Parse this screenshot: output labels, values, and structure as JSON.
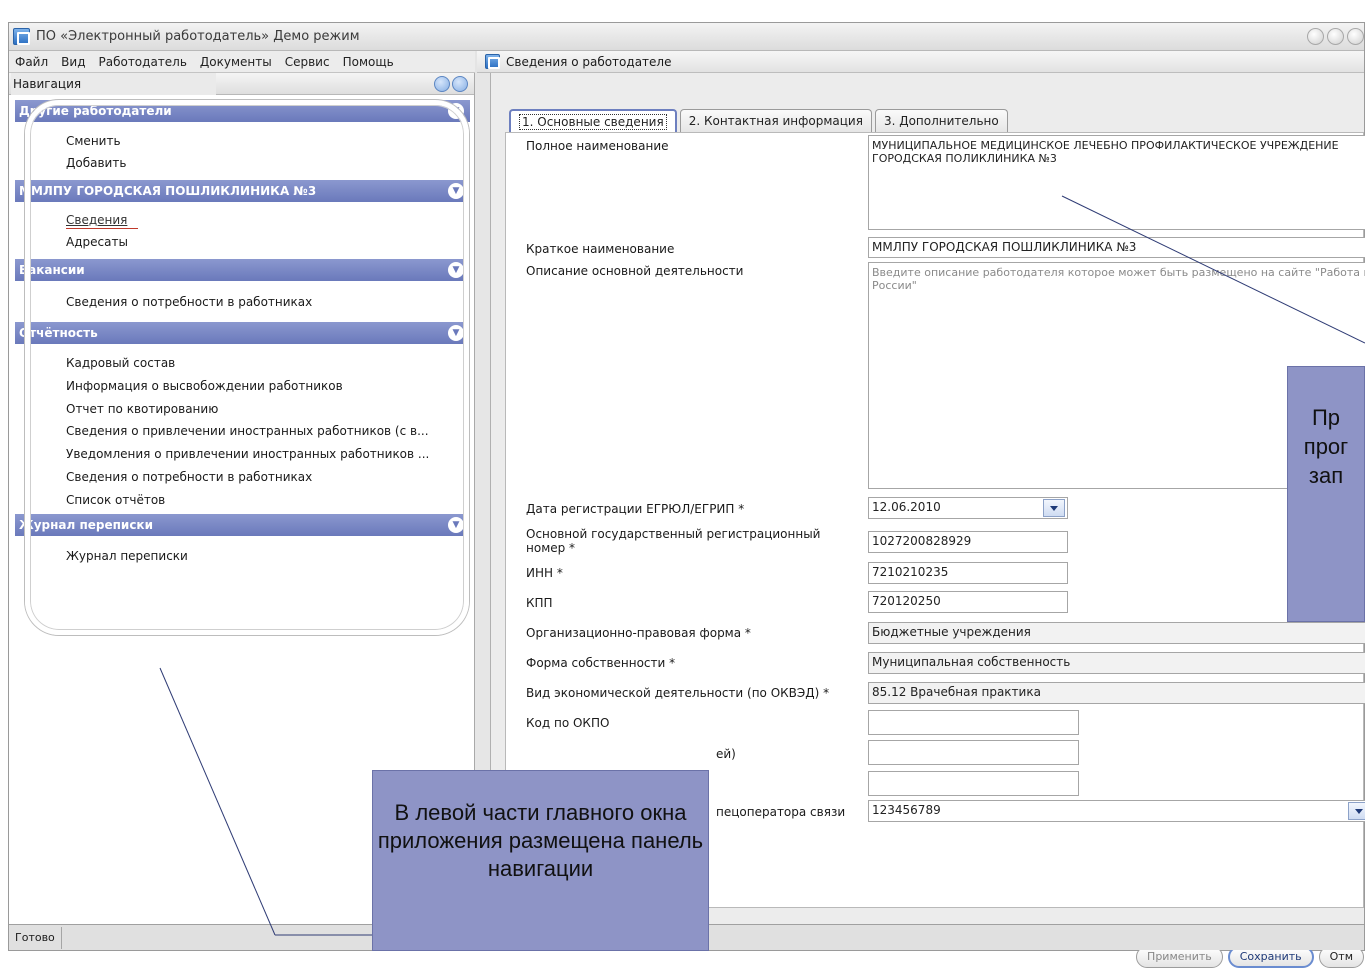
{
  "window": {
    "title": "ПО «Электронный работодатель» Демо режим"
  },
  "menu": [
    "Файл",
    "Вид",
    "Работодатель",
    "Документы",
    "Сервис",
    "Помощь"
  ],
  "document": {
    "title": "Сведения о работодателе"
  },
  "navigation": {
    "header": "Навигация",
    "sections": [
      {
        "title": "Другие работодатели",
        "items": [
          "Сменить",
          "Добавить"
        ]
      },
      {
        "title": "ММЛПУ ГОРОДСКАЯ ПОШЛИКЛИНИКА №3",
        "items": [
          "Сведения",
          "Адресаты"
        ]
      },
      {
        "title": "Вакансии",
        "items": [
          "Сведения о потребности в работниках"
        ]
      },
      {
        "title": "Отчётность",
        "items": [
          "Кадровый состав",
          "Информация о высвобождении работников",
          "Отчет по квотированию",
          "Сведения о привлечении иностранных работников (с в...",
          "Уведомления о привлечении иностранных работников ...",
          "Сведения о потребности в работниках",
          "Список отчётов"
        ]
      },
      {
        "title": "Журнал переписки",
        "items": [
          "Журнал переписки"
        ]
      }
    ]
  },
  "tabs": [
    "1. Основные сведения",
    "2. Контактная информация",
    "3. Дополнительно"
  ],
  "form": {
    "full_name_label": "Полное наименование",
    "full_name_value": "МУНИЦИПАЛЬНОЕ МЕДИЦИНСКОЕ ЛЕЧЕБНО ПРОФИЛАКТИЧЕСКОЕ УЧРЕЖДЕНИЕ ГОРОДСКАЯ ПОЛИКЛИНИКА №3",
    "short_name_label": "Краткое наименование",
    "short_name_value": "ММЛПУ ГОРОДСКАЯ ПОШЛИКЛИНИКА №3",
    "description_label": "Описание основной деятельности",
    "description_placeholder": "Введите описание работодателя которое может быть размещено на сайте \"Работа в России\"",
    "reg_date_label": "Дата регистрации ЕГРЮЛ/ЕГРИП *",
    "reg_date_value": "12.06.2010",
    "ogrn_label": "Основной государственный регистрационный номер *",
    "ogrn_value": "1027200828929",
    "inn_label": "ИНН *",
    "inn_value": "7210210235",
    "kpp_label": "КПП",
    "kpp_value": "720120250",
    "legal_form_label": "Организационно-правовая форма *",
    "legal_form_value": "Бюджетные учреждения",
    "ownership_label": "Форма собственности *",
    "ownership_value": "Муниципальная собственность",
    "okved_label": "Вид экономической деятельности (по ОКВЭД) *",
    "okved_value": "85.12 Врачебная практика",
    "okpo_label": "Код по ОКПО",
    "okpo_value": "",
    "hidden_label_1": "ей)",
    "field_b_value": "",
    "field_c_value": "",
    "operator_label": "пецоператора связи",
    "operator_value": "123456789"
  },
  "buttons": {
    "apply": "Применить",
    "save": "Сохранить",
    "cancel": "Отм"
  },
  "status": {
    "ready": "Готово"
  },
  "callouts": {
    "left": "В левой части главного окна приложения размещена панель навигации",
    "right_lines": [
      "Пр",
      "прог",
      "зап"
    ]
  }
}
